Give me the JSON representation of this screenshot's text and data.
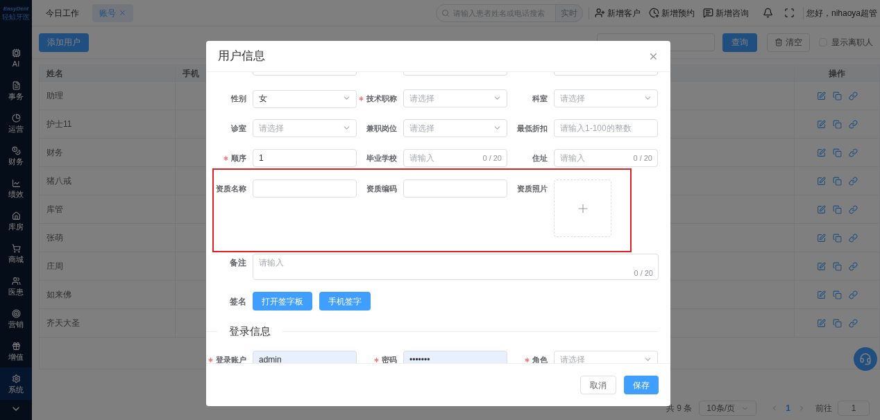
{
  "sidebar": {
    "logo": {
      "name": "EasyDent",
      "subtitle": "轻鲸牙医"
    },
    "items": [
      {
        "label": "AI",
        "selected": false
      },
      {
        "label": "事务",
        "selected": false
      },
      {
        "label": "运营",
        "selected": false
      },
      {
        "label": "财务",
        "selected": false
      },
      {
        "label": "绩效",
        "selected": false
      },
      {
        "label": "库房",
        "selected": false
      },
      {
        "label": "商城",
        "selected": false
      },
      {
        "label": "医患",
        "selected": false
      },
      {
        "label": "营销",
        "selected": false
      },
      {
        "label": "增值",
        "selected": false
      },
      {
        "label": "系统",
        "selected": true
      }
    ]
  },
  "tabs": [
    {
      "label": "今日工作",
      "selected": false,
      "closable": false
    },
    {
      "label": "账号",
      "selected": true,
      "closable": true
    }
  ],
  "header": {
    "search": {
      "placeholder": "请输入患者姓名或电话搜索",
      "button": "实时"
    },
    "actions": [
      "新增客户",
      "新增预约",
      "新增咨询"
    ],
    "greeting": "您好，nihaoya超管"
  },
  "toolbar": {
    "add_button": "添加用户",
    "query_button": "查询",
    "clear_button": "清空",
    "show_resigned": {
      "label": "显示离职人",
      "checked": false
    }
  },
  "table": {
    "columns": [
      "姓名",
      "手机",
      "操作"
    ],
    "rows": [
      {
        "name": "助理"
      },
      {
        "name": "护士11"
      },
      {
        "name": "财务"
      },
      {
        "name": "猪八戒"
      },
      {
        "name": "库管"
      },
      {
        "name": "张萌"
      },
      {
        "name": "庄周"
      },
      {
        "name": "如来佛"
      },
      {
        "name": "齐天大圣"
      }
    ]
  },
  "pagination": {
    "total": "共 9 条",
    "page_size": "10条/页",
    "pages": [
      {
        "label": "1",
        "selected": true
      }
    ],
    "goto_label": "前往",
    "goto_value": "1"
  },
  "dialog": {
    "title": "用户信息",
    "rows": [
      {
        "highlighted": false,
        "fields": [
          {
            "label": "性别",
            "required": false,
            "kind": "select",
            "value": "女"
          },
          {
            "label": "技术职称",
            "required": true,
            "kind": "select",
            "placeholder": "请选择"
          },
          {
            "label": "科室",
            "required": false,
            "kind": "select",
            "placeholder": "请选择"
          }
        ]
      },
      {
        "highlighted": false,
        "fields": [
          {
            "label": "诊室",
            "required": false,
            "kind": "select",
            "placeholder": "请选择"
          },
          {
            "label": "兼职岗位",
            "required": false,
            "kind": "select",
            "placeholder": "请选择"
          },
          {
            "label": "最低折扣",
            "required": false,
            "kind": "input",
            "placeholder": "请输入1-100的整数"
          }
        ]
      },
      {
        "highlighted": false,
        "fields": [
          {
            "label": "顺序",
            "required": true,
            "kind": "input",
            "value": "1"
          },
          {
            "label": "毕业学校",
            "required": false,
            "kind": "input",
            "placeholder": "请输入",
            "counter": "0 / 20"
          },
          {
            "label": "住址",
            "required": false,
            "kind": "input",
            "placeholder": "请输入",
            "counter": "0 / 20"
          }
        ]
      },
      {
        "highlighted": true,
        "fields": [
          {
            "label": "资质名称",
            "required": false,
            "kind": "input"
          },
          {
            "label": "资质编码",
            "required": false,
            "kind": "input"
          },
          {
            "label": "资质照片",
            "required": false,
            "kind": "upload"
          }
        ]
      }
    ],
    "remark": {
      "label": "备注",
      "placeholder": "请输入",
      "counter": "0 / 20"
    },
    "signature": {
      "label": "签名",
      "buttons": [
        "打开签字板",
        "手机签字"
      ]
    },
    "login_section": {
      "title": "登录信息",
      "fields": [
        {
          "label": "登录账户",
          "required": true,
          "kind": "input",
          "value": "admin",
          "autofilled": true
        },
        {
          "label": "密码",
          "required": true,
          "kind": "input",
          "value": "•••••••",
          "autofilled": true
        },
        {
          "label": "角色",
          "required": true,
          "kind": "select",
          "placeholder": "请选择",
          "autofilled": false
        }
      ]
    },
    "footer": {
      "cancel": "取消",
      "save": "保存"
    }
  }
}
